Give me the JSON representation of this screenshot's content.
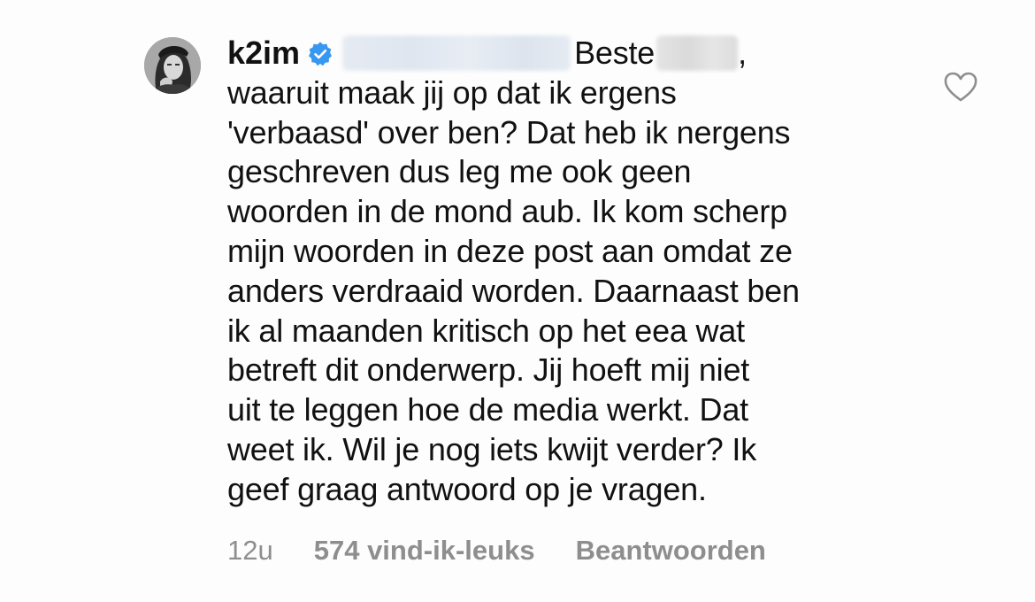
{
  "comment": {
    "username": "k2im",
    "greeting_word": "Beste",
    "greeting_punct": ",",
    "lines": [
      "waaruit maak jij op dat ik ergens",
      "'verbaasd' over ben? Dat heb ik nergens",
      "geschreven dus leg me ook geen",
      "woorden in de mond aub. Ik kom scherp",
      "mijn woorden in deze post aan omdat ze",
      "anders verdraaid worden. Daarnaast ben",
      "ik al maanden kritisch op het eea wat",
      "betreft dit onderwerp. Jij hoeft mij niet",
      "uit te leggen hoe de media werkt. Dat",
      "weet ik. Wil je nog iets kwijt verder? Ik",
      "geef graag antwoord op je vragen."
    ],
    "time": "12u",
    "likes": "574 vind-ik-leuks",
    "reply": "Beantwoorden"
  },
  "icons": {
    "verified": "verified-badge-icon",
    "like": "heart-outline-icon"
  },
  "colors": {
    "verified": "#3897f0",
    "meta_text": "#8e8e8e",
    "text": "#111111"
  }
}
